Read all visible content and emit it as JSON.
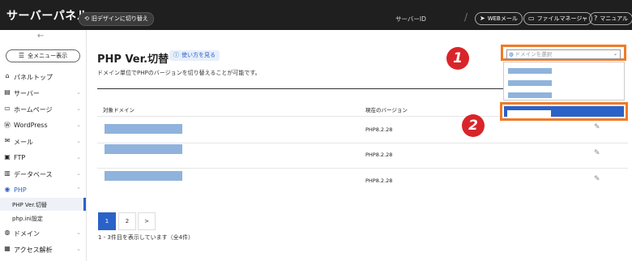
{
  "topbar": {
    "brand": "サーバーパネル",
    "old_design_label": "旧デザインに切り替え",
    "server_id_label": "サーバーID",
    "separator": "/",
    "webmail_label": "WEBメール",
    "file_manager_label": "ファイルマネージャ",
    "manual_label": "マニュアル"
  },
  "sidebar": {
    "collapse_glyph": "←",
    "all_menu_label": "全メニュー表示",
    "items": [
      {
        "label": "パネルトップ",
        "icon": "home-icon",
        "chevron": false
      },
      {
        "label": "サーバー",
        "icon": "server-icon",
        "chevron": true
      },
      {
        "label": "ホームページ",
        "icon": "window-icon",
        "chevron": true
      },
      {
        "label": "WordPress",
        "icon": "wordpress-icon",
        "chevron": true
      },
      {
        "label": "メール",
        "icon": "mail-icon",
        "chevron": true
      },
      {
        "label": "FTP",
        "icon": "monitor-icon",
        "chevron": true
      },
      {
        "label": "データベース",
        "icon": "database-icon",
        "chevron": true
      },
      {
        "label": "PHP",
        "icon": "php-icon",
        "chevron": true,
        "expanded": true
      }
    ],
    "sub_items": [
      {
        "label": "PHP Ver.切替",
        "active": true
      },
      {
        "label": "php.ini設定",
        "active": false
      }
    ],
    "bottom_items": [
      {
        "label": "ドメイン",
        "icon": "globe-icon",
        "chevron": true
      },
      {
        "label": "アクセス解析",
        "icon": "chart-icon",
        "chevron": true
      }
    ]
  },
  "main": {
    "title": "PHP Ver.切替",
    "howto_label": "使い方を見る",
    "description": "ドメイン単位でPHPのバージョンを切り替えることが可能です。",
    "columns": {
      "domain": "対象ドメイン",
      "version": "現在のバージョン"
    },
    "rows": [
      {
        "version": "PHP8.2.28"
      },
      {
        "version": "PHP8.2.28"
      },
      {
        "version": "PHP8.2.28"
      }
    ],
    "pagination": {
      "pages": [
        "1",
        "2"
      ],
      "next": ">",
      "current": "1"
    },
    "count_text": "1 - 3件目を表示しています（全4件）"
  },
  "dropdown": {
    "placeholder": "ドメインを選択"
  },
  "annotations": [
    "1",
    "2"
  ],
  "colors": {
    "accent": "#2b62c8",
    "highlight": "#f07a26",
    "badge": "#d9252a",
    "redaction": "#8fb3dc"
  }
}
